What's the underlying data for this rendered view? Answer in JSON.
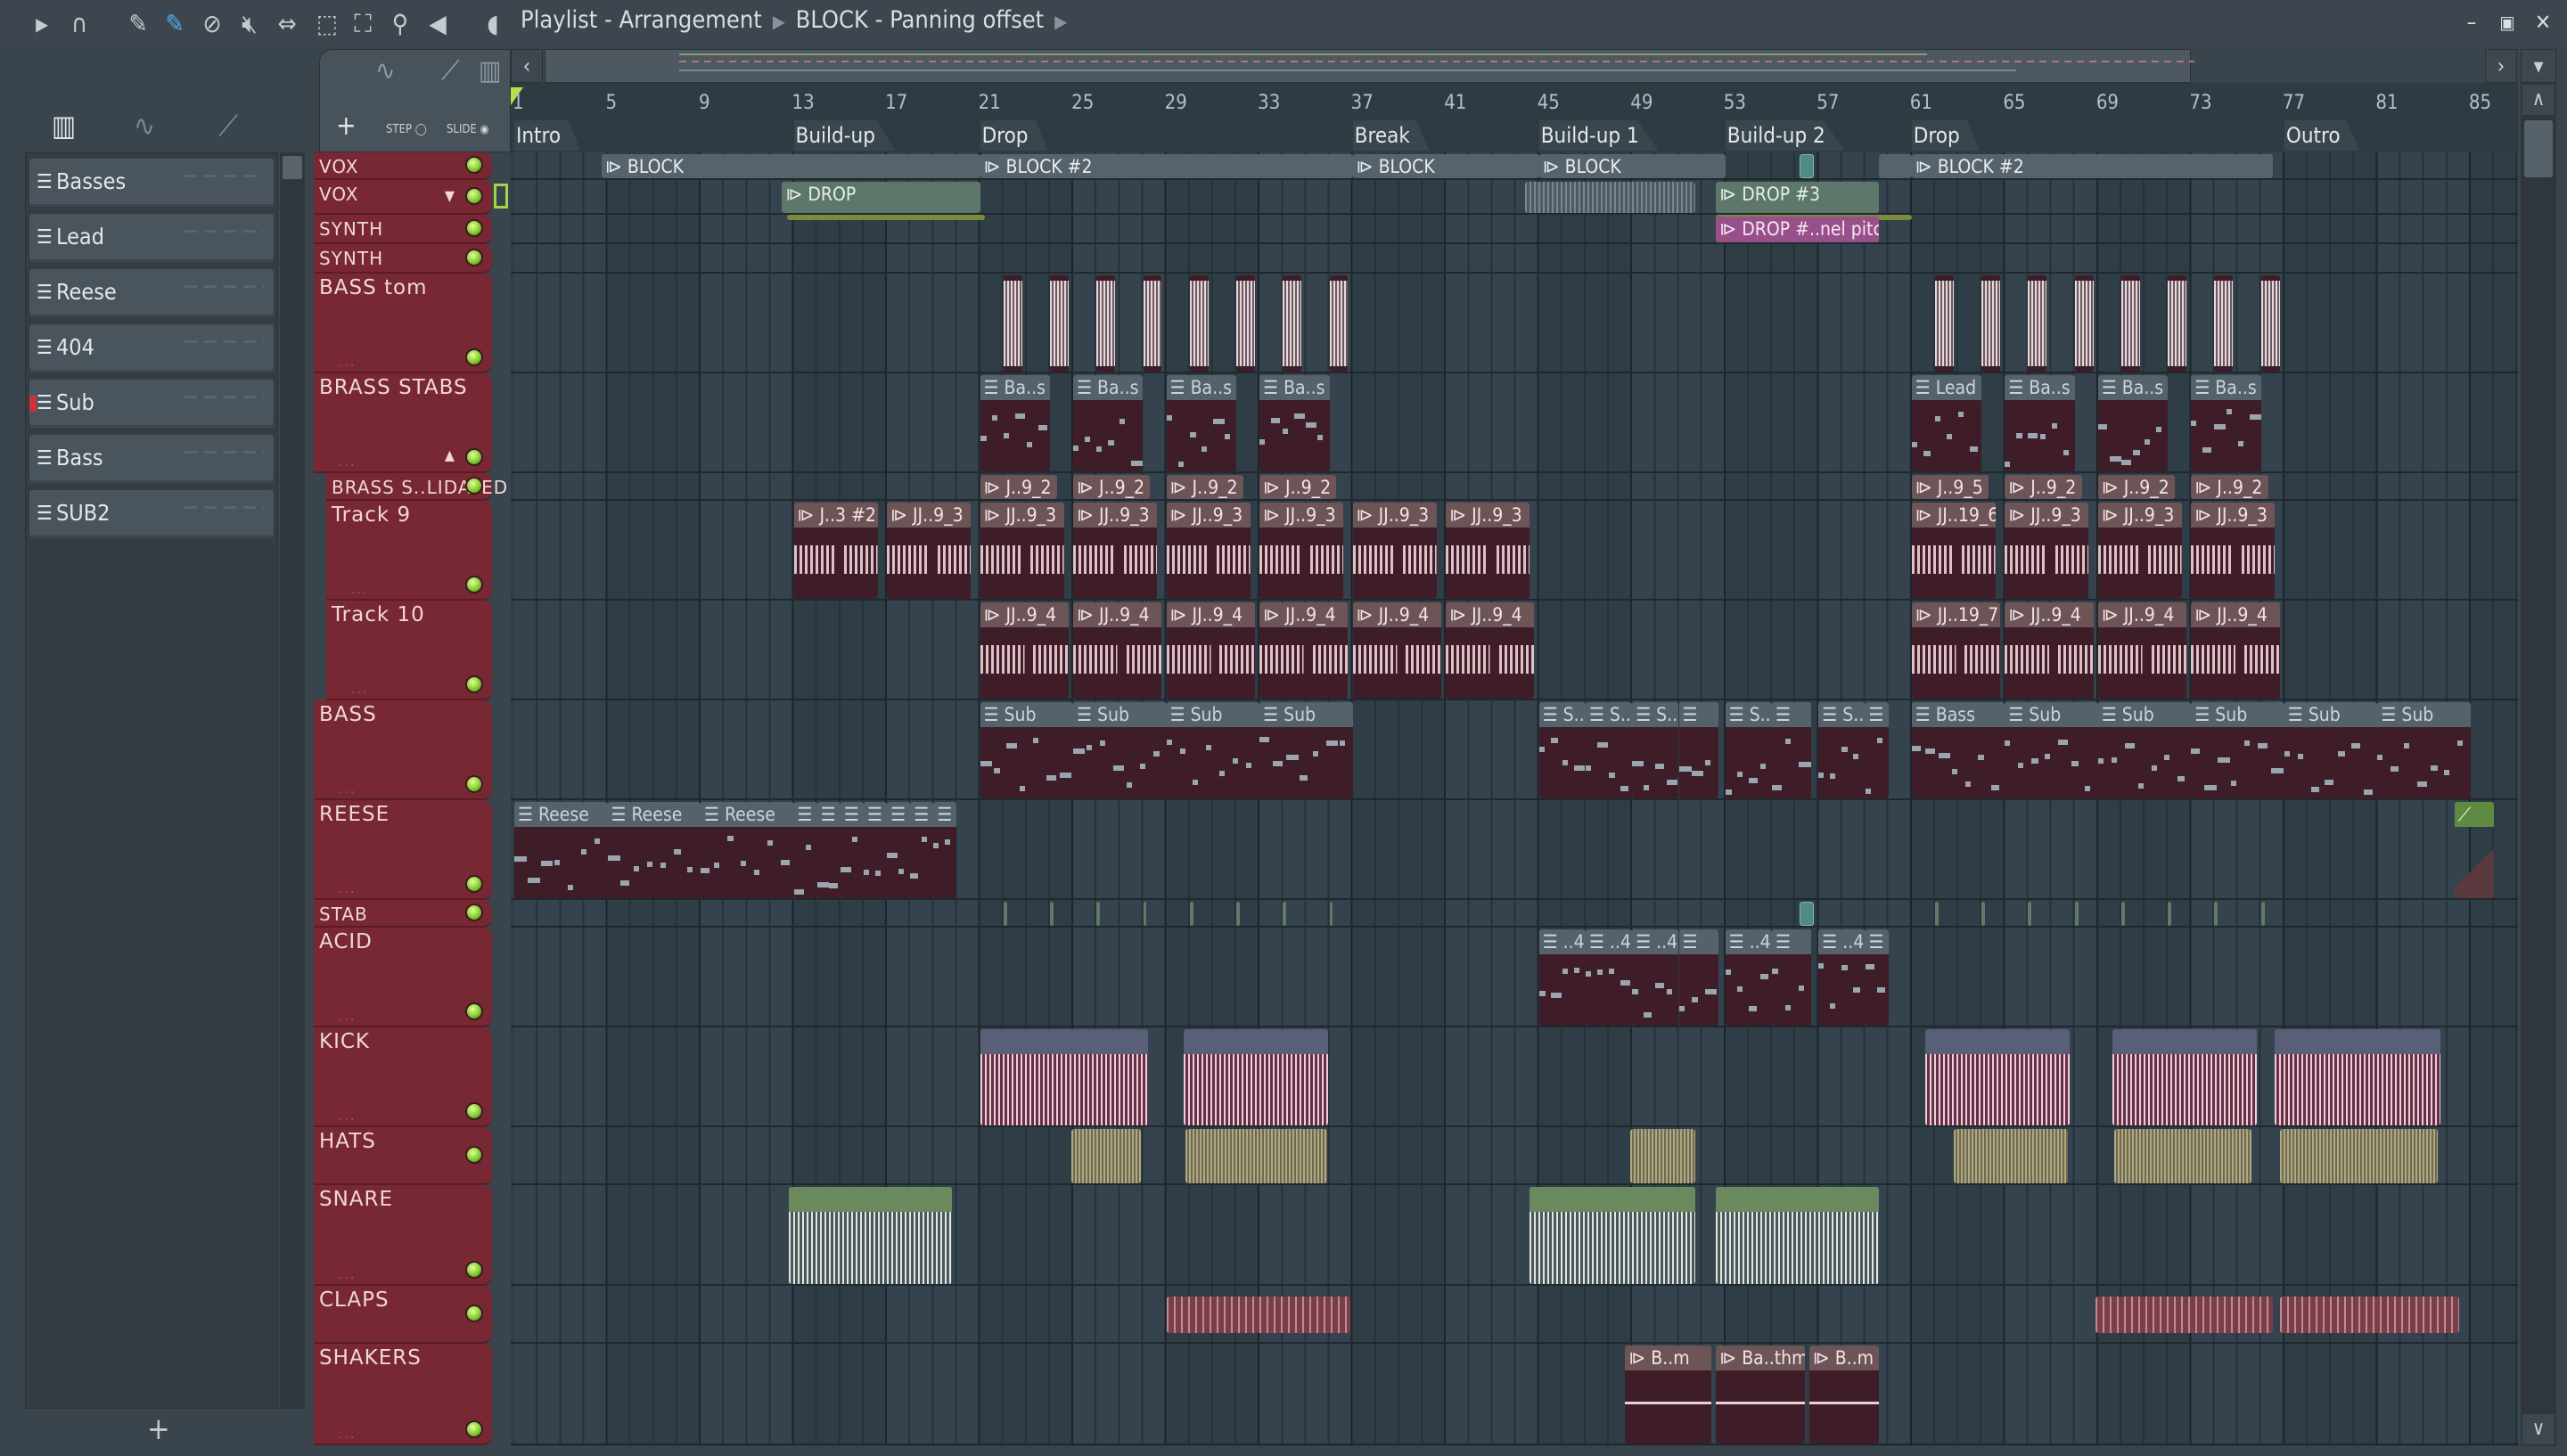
{
  "window": {
    "title": "Playlist - Arrangement",
    "subtitle": "BLOCK - Panning offset",
    "controls": [
      "minimize",
      "maximize",
      "close"
    ]
  },
  "toolbar": {
    "icons": [
      "menu-arrow",
      "magnet-snap",
      "pencil",
      "paint-brush",
      "delete",
      "mute",
      "slip",
      "select",
      "zoom",
      "playback",
      "speaker"
    ],
    "active_tool": "paint-brush",
    "accent": "#4fb0f0"
  },
  "left_panel": {
    "items": [
      {
        "label": "Basses"
      },
      {
        "label": "Lead"
      },
      {
        "label": "Reese"
      },
      {
        "label": "404"
      },
      {
        "label": "Sub",
        "selected": true
      },
      {
        "label": "Bass"
      },
      {
        "label": "SUB2"
      }
    ],
    "add_label": "+"
  },
  "controls": {
    "add_label": "+",
    "step_label": "STEP",
    "slide_label": "SLIDE"
  },
  "ruler": {
    "bars": [
      "1",
      "5",
      "9",
      "13",
      "17",
      "21",
      "25",
      "29",
      "33",
      "37",
      "41",
      "45",
      "49",
      "53",
      "57",
      "61",
      "65",
      "69",
      "73",
      "77",
      "81",
      "85"
    ],
    "markers": [
      {
        "label": "Intro",
        "bar": 1
      },
      {
        "label": "Build-up",
        "bar": 13
      },
      {
        "label": "Drop",
        "bar": 21
      },
      {
        "label": "Break",
        "bar": 37
      },
      {
        "label": "Build-up 1",
        "bar": 45
      },
      {
        "label": "Build-up 2",
        "bar": 53
      },
      {
        "label": "Drop",
        "bar": 61
      },
      {
        "label": "Outro",
        "bar": 77
      }
    ]
  },
  "tracks": [
    {
      "name": "VOX",
      "clips": [
        {
          "t": "blk",
          "s": 4.75,
          "l": 16.25,
          "label": "BLOCK"
        },
        {
          "t": "blk",
          "s": 21,
          "l": 16,
          "label": "BLOCK #2"
        },
        {
          "t": "blk",
          "s": 37,
          "l": 8,
          "label": "BLOCK"
        },
        {
          "t": "blk",
          "s": 45,
          "l": 8,
          "label": "BLOCK"
        },
        {
          "t": "teal",
          "s": 56.2,
          "l": 0.6,
          "label": ""
        },
        {
          "t": "blk",
          "s": 59.6,
          "l": 1.4,
          "label": ""
        },
        {
          "t": "blk",
          "s": 61,
          "l": 15.5,
          "label": "BLOCK #2"
        }
      ]
    },
    {
      "name": "VOX",
      "clips": [
        {
          "t": "drop",
          "s": 12.5,
          "l": 8.5,
          "label": "DROP"
        },
        {
          "t": "grey",
          "s": 44.4,
          "l": 7.3,
          "label": ""
        },
        {
          "t": "drop",
          "s": 52.6,
          "l": 7,
          "label": "DROP #3"
        }
      ]
    },
    {
      "name": "SYNTH",
      "clips": [
        {
          "t": "olive",
          "s": 12.7,
          "l": 8.5,
          "label": ""
        },
        {
          "t": "olive",
          "s": 52.6,
          "l": 8.4,
          "label": ""
        },
        {
          "t": "pink",
          "s": 52.6,
          "l": 7,
          "label": "DROP #..nel pitch"
        }
      ]
    },
    {
      "name": "SYNTH",
      "clips": []
    },
    {
      "name": "BASS tom",
      "clips": [
        {
          "t": "aud",
          "s": 22,
          "l": 0.8,
          "label": ""
        },
        {
          "t": "aud",
          "s": 24,
          "l": 0.8,
          "label": ""
        },
        {
          "t": "aud",
          "s": 26,
          "l": 0.8,
          "label": ""
        },
        {
          "t": "aud",
          "s": 28,
          "l": 0.8,
          "label": ""
        },
        {
          "t": "aud",
          "s": 30,
          "l": 0.8,
          "label": ""
        },
        {
          "t": "aud",
          "s": 32,
          "l": 0.8,
          "label": ""
        },
        {
          "t": "aud",
          "s": 34,
          "l": 0.8,
          "label": ""
        },
        {
          "t": "aud",
          "s": 36,
          "l": 0.8,
          "label": ""
        },
        {
          "t": "aud",
          "s": 62,
          "l": 0.8,
          "label": ""
        },
        {
          "t": "aud",
          "s": 64,
          "l": 0.8,
          "label": ""
        },
        {
          "t": "aud",
          "s": 66,
          "l": 0.8,
          "label": ""
        },
        {
          "t": "aud",
          "s": 68,
          "l": 0.8,
          "label": ""
        },
        {
          "t": "aud",
          "s": 70,
          "l": 0.8,
          "label": ""
        },
        {
          "t": "aud",
          "s": 72,
          "l": 0.8,
          "label": ""
        },
        {
          "t": "aud",
          "s": 74,
          "l": 0.8,
          "label": ""
        },
        {
          "t": "aud",
          "s": 76,
          "l": 0.8,
          "label": ""
        }
      ]
    },
    {
      "name": "BRASS STABS",
      "clips": [
        {
          "t": "pat",
          "s": 21,
          "l": 3,
          "label": "Ba..s"
        },
        {
          "t": "pat",
          "s": 25,
          "l": 3,
          "label": "Ba..s"
        },
        {
          "t": "pat",
          "s": 29,
          "l": 3,
          "label": "Ba..s"
        },
        {
          "t": "pat",
          "s": 33,
          "l": 3,
          "label": "Ba..s"
        },
        {
          "t": "pat",
          "s": 61,
          "l": 3,
          "label": "Lead"
        },
        {
          "t": "pat",
          "s": 65,
          "l": 3,
          "label": "Ba..s"
        },
        {
          "t": "pat",
          "s": 69,
          "l": 3,
          "label": "Ba..s"
        },
        {
          "t": "pat",
          "s": 73,
          "l": 3,
          "label": "Ba..s"
        }
      ]
    },
    {
      "name": "BRASS S..LIDATED",
      "sub": true,
      "clips": [
        {
          "t": "aud",
          "s": 21,
          "l": 3.3,
          "label": "J..9_2"
        },
        {
          "t": "aud",
          "s": 25,
          "l": 3.3,
          "label": "J..9_2"
        },
        {
          "t": "aud",
          "s": 29,
          "l": 3.3,
          "label": "J..9_2"
        },
        {
          "t": "aud",
          "s": 33,
          "l": 3.3,
          "label": "J..9_2"
        },
        {
          "t": "aud",
          "s": 61,
          "l": 3.3,
          "label": "J..9_5"
        },
        {
          "t": "aud",
          "s": 65,
          "l": 3.3,
          "label": "J..9_2"
        },
        {
          "t": "aud",
          "s": 69,
          "l": 3.3,
          "label": "J..9_2"
        },
        {
          "t": "aud",
          "s": 73,
          "l": 3.3,
          "label": "J..9_2"
        }
      ]
    },
    {
      "name": "Track 9",
      "sub": true,
      "clips": [
        {
          "t": "aud",
          "s": 13,
          "l": 3.6,
          "label": "J..3 #2"
        },
        {
          "t": "aud",
          "s": 17,
          "l": 3.6,
          "label": "JJ..9_3"
        },
        {
          "t": "aud",
          "s": 21,
          "l": 3.6,
          "label": "JJ..9_3"
        },
        {
          "t": "aud",
          "s": 25,
          "l": 3.6,
          "label": "JJ..9_3"
        },
        {
          "t": "aud",
          "s": 29,
          "l": 3.6,
          "label": "JJ..9_3"
        },
        {
          "t": "aud",
          "s": 33,
          "l": 3.6,
          "label": "JJ..9_3"
        },
        {
          "t": "aud",
          "s": 37,
          "l": 3.6,
          "label": "JJ..9_3"
        },
        {
          "t": "aud",
          "s": 41,
          "l": 3.6,
          "label": "JJ..9_3"
        },
        {
          "t": "aud",
          "s": 61,
          "l": 3.6,
          "label": "JJ..19_6"
        },
        {
          "t": "aud",
          "s": 65,
          "l": 3.6,
          "label": "JJ..9_3"
        },
        {
          "t": "aud",
          "s": 69,
          "l": 3.6,
          "label": "JJ..9_3"
        },
        {
          "t": "aud",
          "s": 73,
          "l": 3.6,
          "label": "JJ..9_3"
        }
      ]
    },
    {
      "name": "Track 10",
      "sub": true,
      "clips": [
        {
          "t": "aud",
          "s": 21,
          "l": 3.8,
          "label": "JJ..9_4"
        },
        {
          "t": "aud",
          "s": 25,
          "l": 3.8,
          "label": "JJ..9_4"
        },
        {
          "t": "aud",
          "s": 29,
          "l": 3.8,
          "label": "JJ..9_4"
        },
        {
          "t": "aud",
          "s": 33,
          "l": 3.8,
          "label": "JJ..9_4"
        },
        {
          "t": "aud",
          "s": 37,
          "l": 3.8,
          "label": "JJ..9_4"
        },
        {
          "t": "aud",
          "s": 41,
          "l": 3.8,
          "label": "JJ..9_4"
        },
        {
          "t": "aud",
          "s": 61,
          "l": 3.8,
          "label": "JJ..19_7"
        },
        {
          "t": "aud",
          "s": 65,
          "l": 3.8,
          "label": "JJ..9_4"
        },
        {
          "t": "aud",
          "s": 69,
          "l": 3.8,
          "label": "JJ..9_4"
        },
        {
          "t": "aud",
          "s": 73,
          "l": 3.8,
          "label": "JJ..9_4"
        }
      ]
    },
    {
      "name": "BASS",
      "clips": [
        {
          "t": "pat",
          "s": 21,
          "l": 4,
          "label": "Sub"
        },
        {
          "t": "pat",
          "s": 25,
          "l": 4,
          "label": "Sub"
        },
        {
          "t": "pat",
          "s": 29,
          "l": 4,
          "label": "Sub"
        },
        {
          "t": "pat",
          "s": 33,
          "l": 4,
          "label": "Sub"
        },
        {
          "t": "pat",
          "s": 45,
          "l": 2,
          "label": "S.."
        },
        {
          "t": "pat",
          "s": 47,
          "l": 2,
          "label": "S.."
        },
        {
          "t": "pat",
          "s": 49,
          "l": 2,
          "label": "S.."
        },
        {
          "t": "pat",
          "s": 51,
          "l": 1.7,
          "label": ""
        },
        {
          "t": "pat",
          "s": 53,
          "l": 2,
          "label": "S.."
        },
        {
          "t": "pat",
          "s": 55,
          "l": 1.7,
          "label": ""
        },
        {
          "t": "pat",
          "s": 57,
          "l": 2,
          "label": "S.."
        },
        {
          "t": "pat",
          "s": 59,
          "l": 1,
          "label": ""
        },
        {
          "t": "pat",
          "s": 61,
          "l": 4,
          "label": "Bass"
        },
        {
          "t": "pat",
          "s": 65,
          "l": 4,
          "label": "Sub"
        },
        {
          "t": "pat",
          "s": 69,
          "l": 4,
          "label": "Sub"
        },
        {
          "t": "pat",
          "s": 73,
          "l": 4,
          "label": "Sub"
        },
        {
          "t": "pat",
          "s": 77,
          "l": 4,
          "label": "Sub"
        },
        {
          "t": "pat",
          "s": 81,
          "l": 4,
          "label": "Sub"
        }
      ]
    },
    {
      "name": "REESE",
      "clips": [
        {
          "t": "pat",
          "s": 1,
          "l": 4,
          "label": "Reese"
        },
        {
          "t": "pat",
          "s": 5,
          "l": 4,
          "label": "Reese"
        },
        {
          "t": "pat",
          "s": 9,
          "l": 4,
          "label": "Reese"
        },
        {
          "t": "pat",
          "s": 13,
          "l": 1,
          "label": ""
        },
        {
          "t": "pat",
          "s": 14,
          "l": 1,
          "label": ""
        },
        {
          "t": "pat",
          "s": 15,
          "l": 1,
          "label": ""
        },
        {
          "t": "pat",
          "s": 16,
          "l": 1,
          "label": ""
        },
        {
          "t": "pat",
          "s": 17,
          "l": 1,
          "label": ""
        },
        {
          "t": "pat",
          "s": 18,
          "l": 1,
          "label": ""
        },
        {
          "t": "pat",
          "s": 19,
          "l": 1,
          "label": ""
        },
        {
          "t": "autoc",
          "s": 84.3,
          "l": 1.7,
          "label": ""
        }
      ]
    },
    {
      "name": "STAB",
      "clips": [
        {
          "t": "tick",
          "s": 22,
          "l": 0.15,
          "label": ""
        },
        {
          "t": "tick",
          "s": 24,
          "l": 0.15,
          "label": ""
        },
        {
          "t": "tick",
          "s": 26,
          "l": 0.15,
          "label": ""
        },
        {
          "t": "tick",
          "s": 28,
          "l": 0.15,
          "label": ""
        },
        {
          "t": "tick",
          "s": 30,
          "l": 0.15,
          "label": ""
        },
        {
          "t": "tick",
          "s": 32,
          "l": 0.15,
          "label": ""
        },
        {
          "t": "tick",
          "s": 34,
          "l": 0.15,
          "label": ""
        },
        {
          "t": "tick",
          "s": 36,
          "l": 0.15,
          "label": ""
        },
        {
          "t": "teal",
          "s": 56.2,
          "l": 0.6,
          "label": ""
        },
        {
          "t": "tick",
          "s": 62,
          "l": 0.15,
          "label": ""
        },
        {
          "t": "tick",
          "s": 64,
          "l": 0.15,
          "label": ""
        },
        {
          "t": "tick",
          "s": 66,
          "l": 0.15,
          "label": ""
        },
        {
          "t": "tick",
          "s": 68,
          "l": 0.15,
          "label": ""
        },
        {
          "t": "tick",
          "s": 70,
          "l": 0.15,
          "label": ""
        },
        {
          "t": "tick",
          "s": 72,
          "l": 0.15,
          "label": ""
        },
        {
          "t": "tick",
          "s": 74,
          "l": 0.15,
          "label": ""
        },
        {
          "t": "tick",
          "s": 76,
          "l": 0.15,
          "label": ""
        }
      ]
    },
    {
      "name": "ACID",
      "clips": [
        {
          "t": "pat",
          "s": 45,
          "l": 2,
          "label": "..4"
        },
        {
          "t": "pat",
          "s": 47,
          "l": 2,
          "label": "..4"
        },
        {
          "t": "pat",
          "s": 49,
          "l": 2,
          "label": "..4"
        },
        {
          "t": "pat",
          "s": 51,
          "l": 1.7,
          "label": ""
        },
        {
          "t": "pat",
          "s": 53,
          "l": 2,
          "label": "..4"
        },
        {
          "t": "pat",
          "s": 55,
          "l": 1.7,
          "label": ""
        },
        {
          "t": "pat",
          "s": 57,
          "l": 2,
          "label": "..4"
        },
        {
          "t": "pat",
          "s": 59,
          "l": 1,
          "label": ""
        }
      ]
    },
    {
      "name": "KICK",
      "clips": [
        {
          "t": "dense",
          "s": 21,
          "l": 7.2,
          "label": ""
        },
        {
          "t": "dense",
          "s": 29.75,
          "l": 6.2,
          "label": ""
        },
        {
          "t": "dense",
          "s": 61.6,
          "l": 6.2,
          "label": ""
        },
        {
          "t": "dense",
          "s": 69.6,
          "l": 6.2,
          "label": ""
        },
        {
          "t": "dense",
          "s": 76.6,
          "l": 7.1,
          "label": ""
        }
      ]
    },
    {
      "name": "HATS",
      "clips": [
        {
          "t": "hat",
          "s": 24.9,
          "l": 3,
          "label": ""
        },
        {
          "t": "hat",
          "s": 29.8,
          "l": 6.1,
          "label": ""
        },
        {
          "t": "hat",
          "s": 48.9,
          "l": 2.8,
          "label": ""
        },
        {
          "t": "hat",
          "s": 62.8,
          "l": 4.9,
          "label": ""
        },
        {
          "t": "hat",
          "s": 69.7,
          "l": 5.9,
          "label": ""
        },
        {
          "t": "hat",
          "s": 76.8,
          "l": 6.8,
          "label": ""
        }
      ]
    },
    {
      "name": "SNARE",
      "clips": [
        {
          "t": "snare",
          "s": 12.8,
          "l": 7,
          "label": ""
        },
        {
          "t": "snare",
          "s": 44.6,
          "l": 7.1,
          "label": ""
        },
        {
          "t": "snare",
          "s": 52.6,
          "l": 7,
          "label": ""
        }
      ]
    },
    {
      "name": "CLAPS",
      "clips": [
        {
          "t": "clap",
          "s": 29,
          "l": 7.9,
          "label": ""
        },
        {
          "t": "clap",
          "s": 68.9,
          "l": 7.6,
          "label": ""
        },
        {
          "t": "clap",
          "s": 76.8,
          "l": 7.7,
          "label": ""
        }
      ]
    },
    {
      "name": "SHAKERS",
      "clips": [
        {
          "t": "aud",
          "s": 48.7,
          "l": 3.7,
          "label": "B..m"
        },
        {
          "t": "aud",
          "s": 52.6,
          "l": 3.8,
          "label": "Ba..thm"
        },
        {
          "t": "aud",
          "s": 56.6,
          "l": 3,
          "label": "B..m"
        }
      ]
    }
  ],
  "colors": {
    "track_header": "#772833",
    "clip_body": "#3e1d28",
    "led": "#7cc62a",
    "grid": "#2f3d46"
  }
}
